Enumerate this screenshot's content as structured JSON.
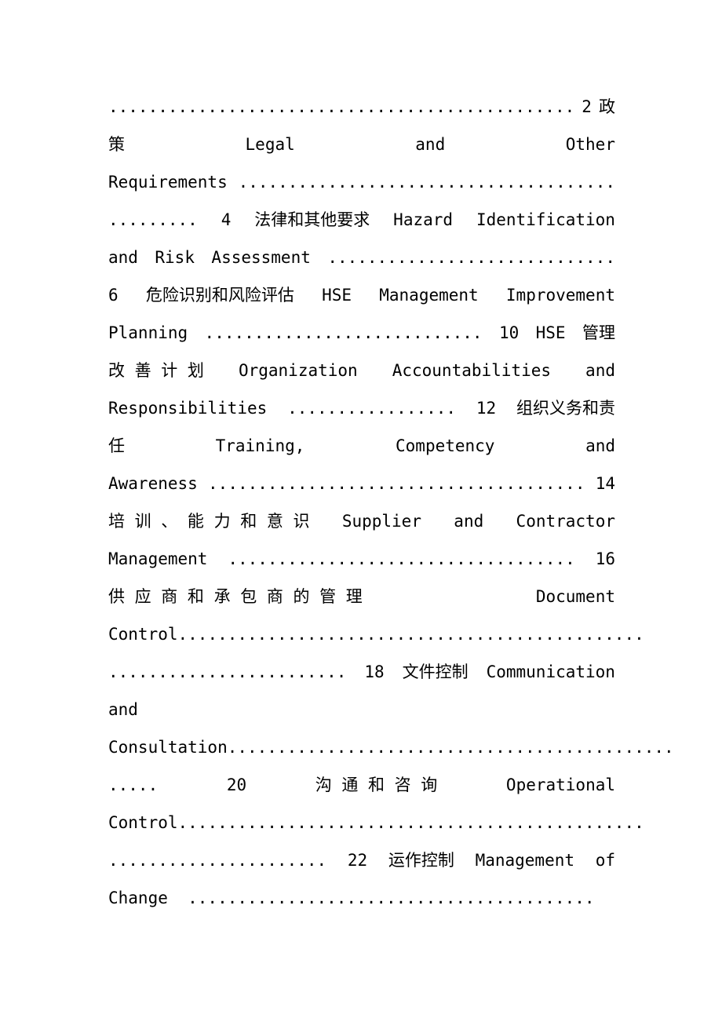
{
  "document": {
    "type": "table-of-contents",
    "page_background": "#ffffff",
    "text_color": "#000000",
    "language": "bilingual-en-zh",
    "entries": [
      {
        "title_en": "HSE Policy",
        "page": "2",
        "title_zh": "政策"
      },
      {
        "title_en": "Legal and Other Requirements",
        "page": "4",
        "title_zh": "法律和其他要求"
      },
      {
        "title_en": "Hazard Identification and Risk Assessment",
        "page": "6",
        "title_zh": "危险识别和风险评估"
      },
      {
        "title_en": "HSE Management Improvement Planning",
        "page": "10",
        "title_zh": "HSE 管理改善计划"
      },
      {
        "title_en": "Organization Accountabilities and Responsibilities",
        "page": "12",
        "title_zh": "组织义务和责任"
      },
      {
        "title_en": "Training, Competency and Awareness",
        "page": "14",
        "title_zh": "培训、能力和意识"
      },
      {
        "title_en": "Supplier and Contractor Management",
        "page": "16",
        "title_zh": "供应商和承包商的管理"
      },
      {
        "title_en": "Document Control",
        "page": "18",
        "title_zh": "文件控制"
      },
      {
        "title_en": "Communication and Consultation",
        "page": "20",
        "title_zh": "沟通和咨询"
      },
      {
        "title_en": "Operational Control",
        "page": "22",
        "title_zh": "运作控制"
      },
      {
        "title_en": "Management of Change",
        "page": "",
        "title_zh": ""
      }
    ],
    "lines": [
      {
        "id": "line-01",
        "mode": "just",
        "segments": [
          "...............................................",
          "2",
          "政"
        ]
      },
      {
        "id": "line-02",
        "mode": "just",
        "segments": [
          "策",
          "Legal",
          "and",
          "Other"
        ]
      },
      {
        "id": "line-03",
        "mode": "just",
        "segments": [
          "Requirements",
          "......................................"
        ]
      },
      {
        "id": "line-04",
        "mode": "just",
        "segments": [
          ".........",
          "4",
          "法律和其他要求",
          "Hazard",
          "Identification"
        ]
      },
      {
        "id": "line-05",
        "mode": "just",
        "segments": [
          "and",
          "Risk",
          "Assessment",
          "............................."
        ]
      },
      {
        "id": "line-06",
        "mode": "just",
        "segments": [
          "6",
          "危险识别和风险评估",
          "HSE",
          "Management",
          "Improvement"
        ]
      },
      {
        "id": "line-07",
        "mode": "just",
        "segments": [
          "Planning",
          "............................",
          "10",
          "HSE",
          "管理"
        ]
      },
      {
        "id": "line-08",
        "mode": "just",
        "segments": [
          "改 善 计 划",
          "Organization",
          "Accountabilities",
          "and"
        ]
      },
      {
        "id": "line-09",
        "mode": "just",
        "segments": [
          "Responsibilities",
          ".................",
          "12",
          "组织义务和责"
        ]
      },
      {
        "id": "line-10",
        "mode": "just",
        "segments": [
          "任",
          "Training,",
          "Competency",
          "and"
        ]
      },
      {
        "id": "line-11",
        "mode": "just",
        "segments": [
          "Awareness",
          "......................................",
          "14"
        ]
      },
      {
        "id": "line-12",
        "mode": "just",
        "segments": [
          "培 训 、 能 力 和 意 识",
          "Supplier",
          "and",
          "Contractor"
        ]
      },
      {
        "id": "line-13",
        "mode": "just",
        "segments": [
          "Management",
          "...................................",
          "16"
        ]
      },
      {
        "id": "line-14",
        "mode": "just",
        "segments": [
          "供 应 商 和 承 包 商 的 管 理",
          "Document"
        ]
      },
      {
        "id": "line-15",
        "mode": "just",
        "segments": [
          "Control",
          "..............................................."
        ]
      },
      {
        "id": "line-16",
        "mode": "just",
        "segments": [
          "........................",
          "18",
          "文件控制",
          "Communication"
        ]
      },
      {
        "id": "line-17",
        "mode": "flush",
        "segments": [
          "and"
        ]
      },
      {
        "id": "line-18",
        "mode": "flush",
        "segments": [
          "Consultation............................................."
        ]
      },
      {
        "id": "line-19",
        "mode": "just",
        "segments": [
          ".....",
          "20",
          "沟 通 和 咨 询",
          "Operational"
        ]
      },
      {
        "id": "line-20",
        "mode": "just",
        "segments": [
          "Control",
          "..............................................."
        ]
      },
      {
        "id": "line-21",
        "mode": "just",
        "segments": [
          "......................",
          "22",
          "运作控制",
          "Management",
          "of"
        ]
      },
      {
        "id": "line-22",
        "mode": "flush",
        "segments": [
          "Change  ........................................."
        ]
      }
    ]
  }
}
